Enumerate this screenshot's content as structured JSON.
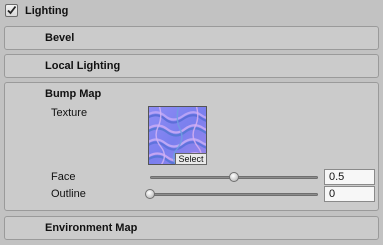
{
  "header": {
    "label": "Lighting",
    "checked": true
  },
  "sections": {
    "bevel": "Bevel",
    "local_lighting": "Local Lighting",
    "bump_map": "Bump Map",
    "environment_map": "Environment Map"
  },
  "bump_map": {
    "texture_label": "Texture",
    "select_label": "Select",
    "face": {
      "label": "Face",
      "value": "0.5",
      "slider_fraction": 0.5
    },
    "outline": {
      "label": "Outline",
      "value": "0",
      "slider_fraction": 0
    }
  },
  "colors": {
    "background": "#c2c2c2",
    "panel": "#cbcbcb",
    "normal_map_base": "#7b7ff0"
  }
}
